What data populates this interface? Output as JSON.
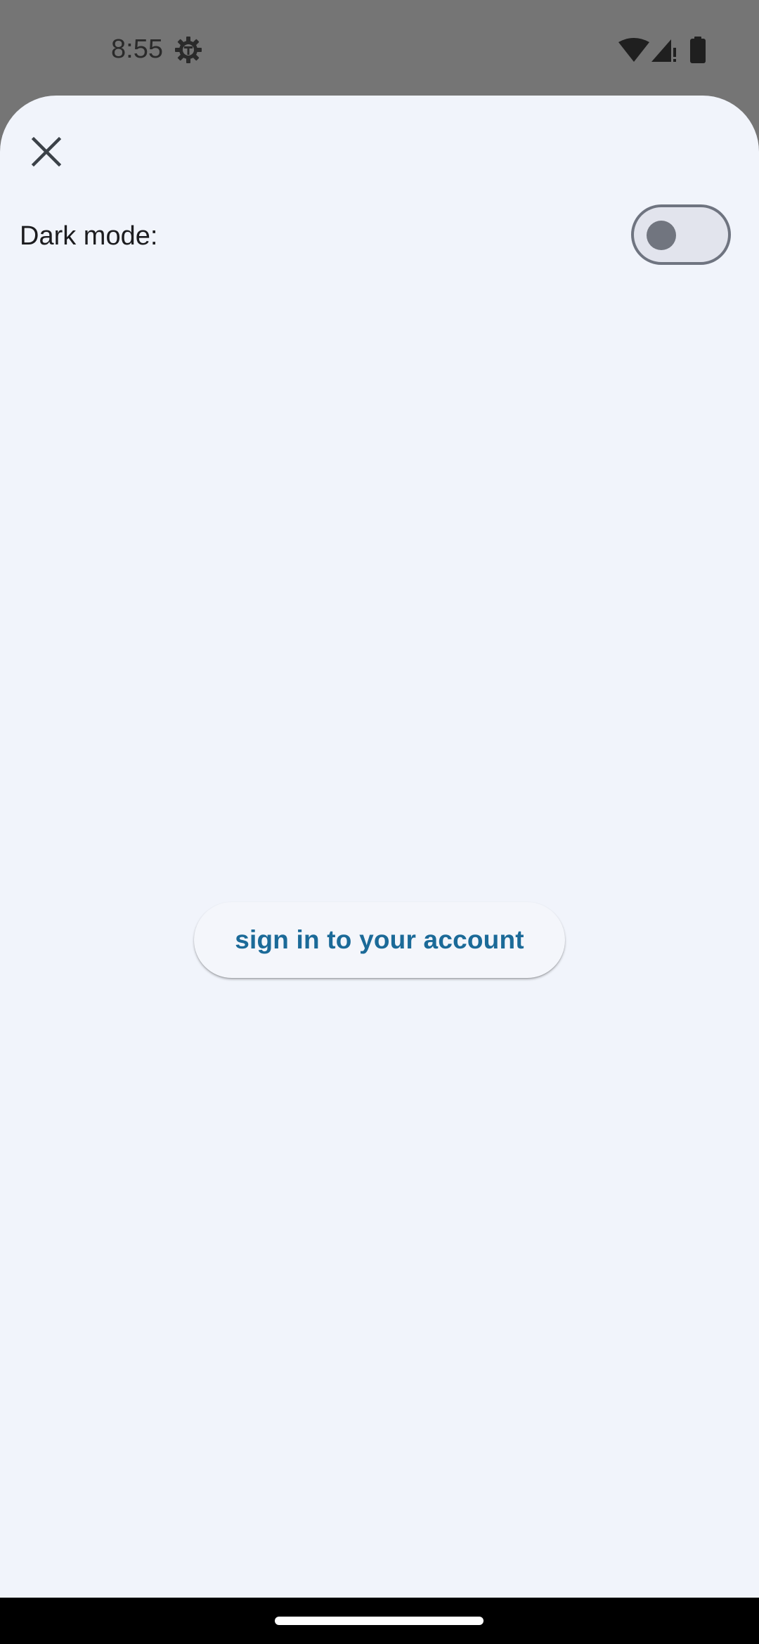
{
  "status_bar": {
    "time": "8:55",
    "icons": [
      "settings-gear-icon",
      "wifi-icon",
      "cell-signal-icon",
      "battery-icon"
    ]
  },
  "sheet": {
    "close_icon": "close-icon",
    "dark_mode": {
      "label": "Dark mode:",
      "enabled": false
    },
    "signin_button": {
      "label": "sign in to your account"
    }
  },
  "colors": {
    "sheet_background": "#f1f4fb",
    "accent_text": "#1b6a98",
    "scrim": "#757575",
    "toggle_track": "#e2e4ed",
    "toggle_outline": "#6f7480"
  }
}
